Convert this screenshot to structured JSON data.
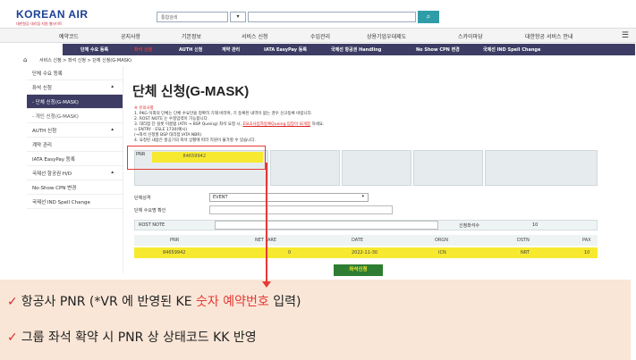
{
  "logo": {
    "name": "KOREAN AIR",
    "tagline": "대한항공 대리점 지원 웹사이트"
  },
  "search": {
    "select_value": "통합검색",
    "button_icon": "search-icon"
  },
  "main_nav": [
    "예약코드",
    "공지사항",
    "기본정보",
    "서비스 신청",
    "수입관리",
    "상용기업우대제도",
    "스카이마당",
    "대한항공 서비스 안내"
  ],
  "sub_nav": [
    "단체 수요 등록",
    "좌석 신청",
    "AUTH 신청",
    "계약 관리",
    "IATA EasyPay 등록",
    "국제선 항공권 Handling",
    "No Show CPN 변경",
    "국제선 IND Spell Change"
  ],
  "breadcrumb": {
    "text": "서비스 신청  >  좌석 신청  >  단체 신청(G-MASK)"
  },
  "sidebar": [
    {
      "label": "단체 수요 등록",
      "chev": ""
    },
    {
      "label": "좌석 신청",
      "chev": "▴"
    },
    {
      "label": "- 단체 신청(G-MASK)",
      "chev": ""
    },
    {
      "label": "- 개인 신청(G-MASK)",
      "chev": ""
    },
    {
      "label": "AUTH 신청",
      "chev": "▴"
    },
    {
      "label": "계약 관리",
      "chev": ""
    },
    {
      "label": "IATA EasyPay 등록",
      "chev": ""
    },
    {
      "label": "국제선 항공권 H/D",
      "chev": "▴"
    },
    {
      "label": "No-Show CPN 변경",
      "chev": ""
    },
    {
      "label": "국제선 IND Spell Change",
      "chev": ""
    }
  ],
  "page_title": "단체 신청(G-MASK)",
  "notes": {
    "heading": "※ 유의사항",
    "line1": "1. PKG 이외의 단체는 단체 수요만을 정확히 기재 바라며, 기 등록된 내역이 없는 경우 신규등록 바랍니다.",
    "line2": "2. ROST NOTE 는 수정입력이 가능합니다.",
    "line3a": "3. 대리점 단 실롯 이름법 (ATR → BSP Queing) 좌석 요청 시, ",
    "line3b": "ESLE사업자등록Queing 입장이 되게함",
    "line3c": " 하세요.",
    "line4": "  ▫ ENTRY : ESLE 1730(예시)",
    "line5": "             (→좌석 신청할 BSP 대리점 IATA NBR)",
    "line6": "4. 요청된 내용은 항공기의 좌석 상황에 따라 지원이 불가할 수 있습니다."
  },
  "form": {
    "pnr_label": "PNR",
    "pnr_value": "84659942",
    "group_type_label": "단체성격",
    "group_type_value": "EVENT",
    "demand_confirm_label": "단체 수요명 확인",
    "rost_note_label": "ROST NOTE",
    "seat_count_label": "신청좌석수",
    "seat_count_value": "10"
  },
  "table": {
    "headers": [
      "PNR",
      "NET FARE",
      "DATE",
      "ORGN",
      "DSTN",
      "PAX"
    ],
    "row": [
      "84659942",
      "0",
      "2022-11-30",
      "ICN",
      "NRT",
      "10"
    ]
  },
  "apply_button": "좌석신청",
  "callout": {
    "line1_prefix": "항공사 PNR (*VR 에 반영된  KE ",
    "line1_red": "숫자 예약번호",
    "line1_suffix": " 입력)",
    "line2": "그룹 좌석 확약 시 PNR 상 상태코드 KK 반영"
  },
  "colors": {
    "subnav_bg": "#3c3c64",
    "highlight_yellow": "#f7e930",
    "annotation_red": "#e53935",
    "callout_bg": "#f9e6d7"
  }
}
